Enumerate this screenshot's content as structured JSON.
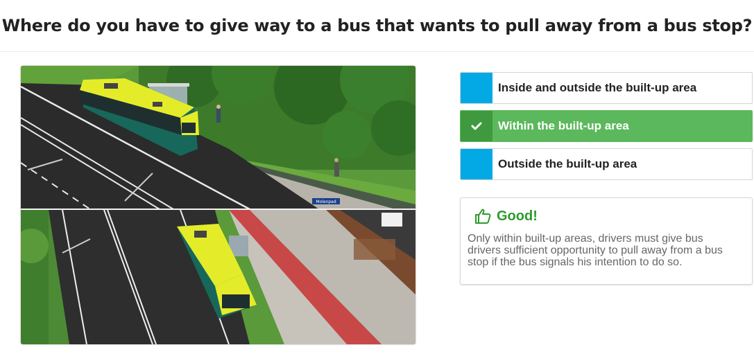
{
  "question": {
    "title": "Where do you have to give way to a bus that wants to pull away from a bus stop?"
  },
  "answers": [
    {
      "label": "Inside and outside the built-up area",
      "state": "default"
    },
    {
      "label": "Within the built-up area",
      "state": "correct"
    },
    {
      "label": "Outside the built-up area",
      "state": "default"
    }
  ],
  "feedback": {
    "title": "Good!",
    "text": "Only within built-up areas, drivers must give bus drivers sufficient opportunity to pull away from a bus stop if the bus signals his intention to do so.",
    "icon": "thumbs-up-icon"
  },
  "scene": {
    "street_sign": "Molenpad"
  },
  "colors": {
    "answer_marker": "#03a9e4",
    "correct_bg": "#5cb85c",
    "correct_marker": "#3f9a3f",
    "feedback_title": "#2e9a2e",
    "bus_body": "#e4ec2a",
    "bus_lower": "#17685a"
  }
}
